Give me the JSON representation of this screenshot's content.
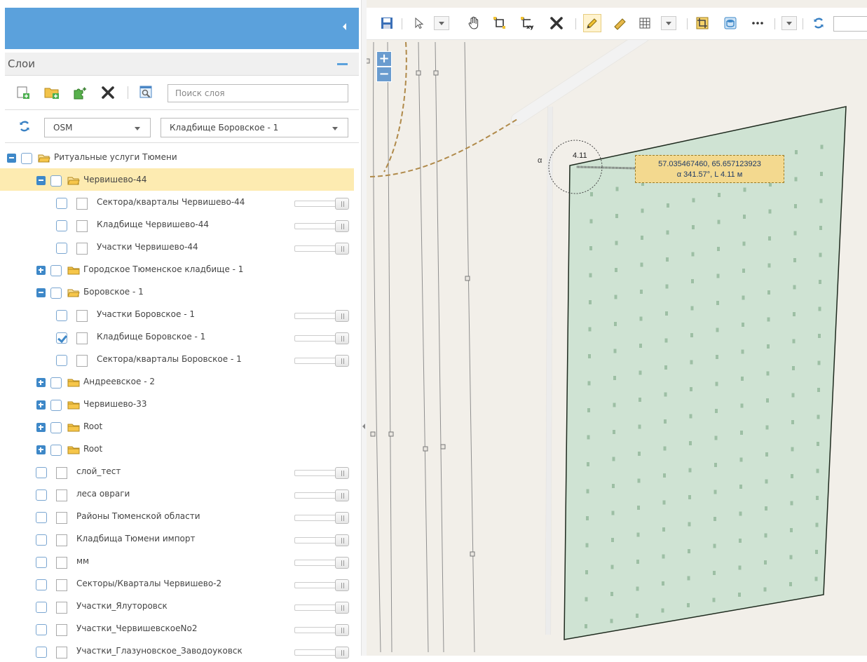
{
  "layers_panel": {
    "title": "Слои",
    "search_placeholder": "Поиск слоя",
    "basemap_select": "OSM",
    "active_layer_select": "Кладбище Боровское - 1"
  },
  "tree": [
    {
      "label": "Ритуальные услуги Тюмени",
      "level": 0,
      "kind": "folder",
      "expander": "minus",
      "open": true,
      "checked": false,
      "slider": false,
      "selected": false
    },
    {
      "label": "Червишево-44",
      "level": 1,
      "kind": "folder",
      "expander": "minus",
      "open": true,
      "checked": false,
      "slider": false,
      "selected": true
    },
    {
      "label": "Сектора/кварталы Червишево-44",
      "level": 2,
      "kind": "layer",
      "checked": false,
      "slider": true
    },
    {
      "label": "Кладбище Червишево-44",
      "level": 2,
      "kind": "layer",
      "checked": false,
      "slider": true
    },
    {
      "label": "Участки Червишево-44",
      "level": 2,
      "kind": "layer",
      "checked": false,
      "slider": true
    },
    {
      "label": "Городское Тюменское кладбище - 1",
      "level": 1,
      "kind": "folder",
      "expander": "plus",
      "open": false,
      "checked": false,
      "slider": false
    },
    {
      "label": "Боровское - 1",
      "level": 1,
      "kind": "folder",
      "expander": "minus",
      "open": true,
      "checked": false,
      "slider": false
    },
    {
      "label": "Участки Боровское - 1",
      "level": 2,
      "kind": "layer",
      "checked": false,
      "slider": true
    },
    {
      "label": "Кладбище Боровское - 1",
      "level": 2,
      "kind": "layer",
      "checked": true,
      "slider": true
    },
    {
      "label": "Сектора/кварталы Боровское - 1",
      "level": 2,
      "kind": "layer",
      "checked": false,
      "slider": true
    },
    {
      "label": "Андреевское - 2",
      "level": 1,
      "kind": "folder",
      "expander": "plus",
      "open": false,
      "checked": false,
      "slider": false
    },
    {
      "label": "Червишево-33",
      "level": 1,
      "kind": "folder",
      "expander": "plus",
      "open": false,
      "checked": false,
      "slider": false
    },
    {
      "label": "Root",
      "level": 1,
      "kind": "folder",
      "expander": "plus",
      "open": false,
      "checked": false,
      "slider": false
    },
    {
      "label": "Root",
      "level": 1,
      "kind": "folder",
      "expander": "plus",
      "open": false,
      "checked": false,
      "slider": false
    },
    {
      "label": "слой_тест",
      "level": 1,
      "kind": "layer",
      "checked": false,
      "slider": true
    },
    {
      "label": "леса овраги",
      "level": 1,
      "kind": "layer",
      "checked": false,
      "slider": true
    },
    {
      "label": "Районы Тюменской области",
      "level": 1,
      "kind": "layer",
      "checked": false,
      "slider": true
    },
    {
      "label": "Кладбища Тюмени импорт",
      "level": 1,
      "kind": "layer",
      "checked": false,
      "slider": true
    },
    {
      "label": "мм",
      "level": 1,
      "kind": "layer",
      "checked": false,
      "slider": true
    },
    {
      "label": "Секторы/Кварталы Червишево-2",
      "level": 1,
      "kind": "layer",
      "checked": false,
      "slider": true
    },
    {
      "label": "Участки_Ялуторовск",
      "level": 1,
      "kind": "layer",
      "checked": false,
      "slider": true
    },
    {
      "label": "Участки_ЧервишевскоеNo2",
      "level": 1,
      "kind": "layer",
      "checked": false,
      "slider": true
    },
    {
      "label": "Участки_Глазуновское_Заводоуковск",
      "level": 1,
      "kind": "layer",
      "checked": false,
      "slider": true
    }
  ],
  "map": {
    "zoom_in": "+",
    "zoom_out": "−",
    "coord_line1": "57.035467460, 65.657123923",
    "coord_line2": "α 341.57°, L 4.11 м",
    "segment_length": "4.11",
    "angle_label": "α",
    "colors": {
      "polygon_fill": "#cfe3d3",
      "polygon_stroke": "#1e2a1e",
      "tooltip_fill": "#f3d98f",
      "panel_header": "#5ba1dc",
      "selected_row": "#fdebb1",
      "path_dashed": "#b08a4a"
    }
  },
  "toolbar_icons": [
    "save-icon",
    "select-arrow-icon",
    "pan-hand-icon",
    "frame-icon",
    "coordinates-xy-icon",
    "delete-icon",
    "pencil-icon",
    "ruler-icon",
    "grid-icon",
    "crop-icon",
    "layers-db-icon",
    "more-icon",
    "refresh-icon"
  ]
}
